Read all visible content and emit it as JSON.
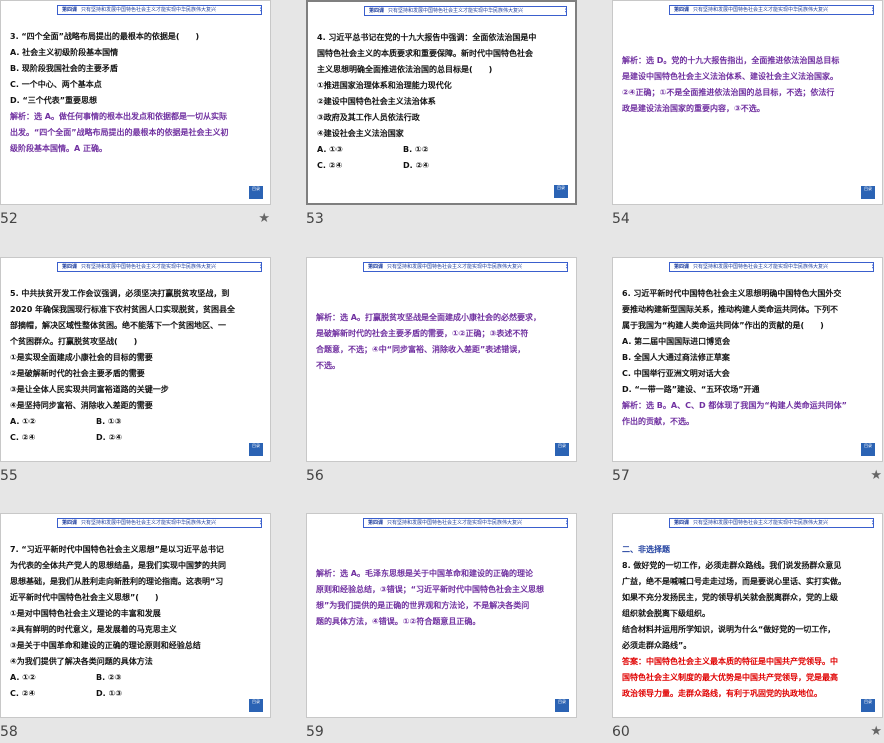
{
  "header": {
    "tag": "第四课",
    "subtitle": "只有坚持和发展中国特色社会主义才能实现中华民族伟大复兴"
  },
  "slides": [
    {
      "number": "52",
      "star": "★",
      "lines": [
        {
          "t": "3. “四个全面”战略布局提出的最根本的依据是(　　)",
          "c": ""
        },
        {
          "t": "A. 社会主义初级阶段基本国情",
          "c": ""
        },
        {
          "t": "B. 现阶段我国社会的主要矛盾",
          "c": ""
        },
        {
          "t": "C. 一个中心、两个基本点",
          "c": ""
        },
        {
          "t": "D. “三个代表”重要思想",
          "c": ""
        },
        {
          "t": "解析：选 A。做任何事情的根本出发点和依据都是一切从实际",
          "c": "purple"
        },
        {
          "t": "出发。“四个全面”战略布局提出的最根本的依据是社会主义初",
          "c": "purple"
        },
        {
          "t": "级阶段基本国情。A 正确。",
          "c": "purple"
        }
      ]
    },
    {
      "number": "53",
      "star": "",
      "lines": [
        {
          "t": "4. 习近平总书记在党的十九大报告中强调：全面依法治国是中",
          "c": ""
        },
        {
          "t": "国特色社会主义的本质要求和重要保障。新时代中国特色社会",
          "c": ""
        },
        {
          "t": "主义思想明确全面推进依法治国的总目标是(　　)",
          "c": ""
        },
        {
          "t": "①推进国家治理体系和治理能力现代化",
          "c": ""
        },
        {
          "t": "②建设中国特色社会主义法治体系",
          "c": ""
        },
        {
          "t": "③政府及其工作人员依法行政",
          "c": ""
        },
        {
          "t": "④建设社会主义法治国家",
          "c": ""
        }
      ],
      "options": [
        [
          "A. ①③",
          "B. ①②"
        ],
        [
          "C. ②④",
          "D. ②④"
        ]
      ]
    },
    {
      "number": "54",
      "star": "",
      "mid": true,
      "lines": [
        {
          "t": "解析：选 D。党的十九大报告指出，全面推进依法治国总目标",
          "c": "purple"
        },
        {
          "t": "是建设中国特色社会主义法治体系、建设社会主义法治国家。",
          "c": "purple"
        },
        {
          "t": "②④正确；①不是全面推进依法治国的总目标，不选；依法行",
          "c": "purple"
        },
        {
          "t": "政是建设法治国家的重要内容，③不选。",
          "c": "purple"
        }
      ]
    },
    {
      "number": "55",
      "star": "",
      "lines": [
        {
          "t": "5. 中共扶贫开发工作会议强调，必须坚决打赢脱贫攻坚战，到",
          "c": ""
        },
        {
          "t": "2020 年确保我国现行标准下农村贫困人口实现脱贫，贫困县全",
          "c": ""
        },
        {
          "t": "部摘帽，解决区域性整体贫困。绝不能落下一个贫困地区、一",
          "c": ""
        },
        {
          "t": "个贫困群众。打赢脱贫攻坚战(　　)",
          "c": ""
        },
        {
          "t": "①是实现全面建成小康社会的目标的需要",
          "c": ""
        },
        {
          "t": "②是破解新时代的社会主要矛盾的需要",
          "c": ""
        },
        {
          "t": "③是让全体人民实现共同富裕道路的关键一步",
          "c": ""
        },
        {
          "t": "④是坚持同步富裕、消除收入差距的需要",
          "c": ""
        }
      ],
      "options": [
        [
          "A. ①②",
          "B. ①③"
        ],
        [
          "C. ②④",
          "D. ②④"
        ]
      ]
    },
    {
      "number": "56",
      "star": "",
      "mid": true,
      "lines": [
        {
          "t": "解析：选 A。打赢脱贫攻坚战是全面建成小康社会的必然要求，",
          "c": "purple"
        },
        {
          "t": "是破解新时代的社会主要矛盾的需要，①②正确；③表述不符",
          "c": "purple"
        },
        {
          "t": "合题意，不选；④中“同步富裕、消除收入差距”表述错误，",
          "c": "purple"
        },
        {
          "t": "不选。",
          "c": "purple"
        }
      ]
    },
    {
      "number": "57",
      "star": "★",
      "lines": [
        {
          "t": "6. 习近平新时代中国特色社会主义思想明确中国特色大国外交",
          "c": ""
        },
        {
          "t": "要推动构建新型国际关系，推动构建人类命运共同体。下列不",
          "c": ""
        },
        {
          "t": "属于我国为“构建人类命运共同体”作出的贡献的是(　　)",
          "c": ""
        },
        {
          "t": "A. 第二届中国国际进口博览会",
          "c": ""
        },
        {
          "t": "B. 全国人大通过商法修正草案",
          "c": ""
        },
        {
          "t": "C. 中国举行亚洲文明对话大会",
          "c": ""
        },
        {
          "t": "D. “一带一路”建设、“五环农场”开通",
          "c": ""
        },
        {
          "t": "解析：选 B。A、C、D 都体现了我国为“构建人类命运共同体”",
          "c": "purple"
        },
        {
          "t": "作出的贡献，不选。",
          "c": "purple"
        }
      ]
    },
    {
      "number": "58",
      "star": "",
      "lines": [
        {
          "t": "7. “习近平新时代中国特色社会主义思想”是以习近平总书记",
          "c": ""
        },
        {
          "t": "为代表的全体共产党人的思想结晶，是我们实现中国梦的共同",
          "c": ""
        },
        {
          "t": "思想基础，是我们从胜利走向新胜利的理论指南。这表明“习",
          "c": ""
        },
        {
          "t": "近平新时代中国特色社会主义思想”(　　)",
          "c": ""
        },
        {
          "t": "①是对中国特色社会主义理论的丰富和发展",
          "c": ""
        },
        {
          "t": "②具有鲜明的时代意义，是发展着的马克思主义",
          "c": ""
        },
        {
          "t": "③是关于中国革命和建设的正确的理论原则和经验总结",
          "c": ""
        },
        {
          "t": "④为我们提供了解决各类问题的具体方法",
          "c": ""
        }
      ],
      "options": [
        [
          "A. ①②",
          "B. ②③"
        ],
        [
          "C. ②④",
          "D. ①③"
        ]
      ]
    },
    {
      "number": "59",
      "star": "",
      "mid": true,
      "lines": [
        {
          "t": "解析：选 A。毛泽东思想是关于中国革命和建设的正确的理论",
          "c": "purple"
        },
        {
          "t": "原则和经验总结，③错误；“习近平新时代中国特色社会主义思想",
          "c": "purple"
        },
        {
          "t": "想”为我们提供的是正确的世界观和方法论，不是解决各类问",
          "c": "purple"
        },
        {
          "t": "题的具体方法，④错误。①②符合题意且正确。",
          "c": "purple"
        }
      ]
    },
    {
      "number": "60",
      "star": "★",
      "lines": [
        {
          "t": "二、非选择题",
          "c": "blue"
        },
        {
          "t": "8. 做好党的一切工作，必须走群众路线。我们说发扬群众意见",
          "c": ""
        },
        {
          "t": "广益，绝不是喊喊口号走走过场，而是要说心里话、实打实做。",
          "c": ""
        },
        {
          "t": "如果不充分发扬民主，党的领导机关就会脱离群众，党的上级",
          "c": ""
        },
        {
          "t": "组织就会脱离下级组织。",
          "c": ""
        },
        {
          "t": "结合材料并运用所学知识，说明为什么“做好党的一切工作，",
          "c": ""
        },
        {
          "t": "必须走群众路线”。",
          "c": ""
        },
        {
          "t": "答案：中国特色社会主义最本质的特征是中国共产党领导。中",
          "c": "red"
        },
        {
          "t": "国特色社会主义制度的最大优势是中国共产党领导，党是最高",
          "c": "red"
        },
        {
          "t": "政治领导力量。走群众路线，有利于巩固党的执政地位。",
          "c": "red"
        }
      ]
    }
  ],
  "panel_icon_label": "目录"
}
